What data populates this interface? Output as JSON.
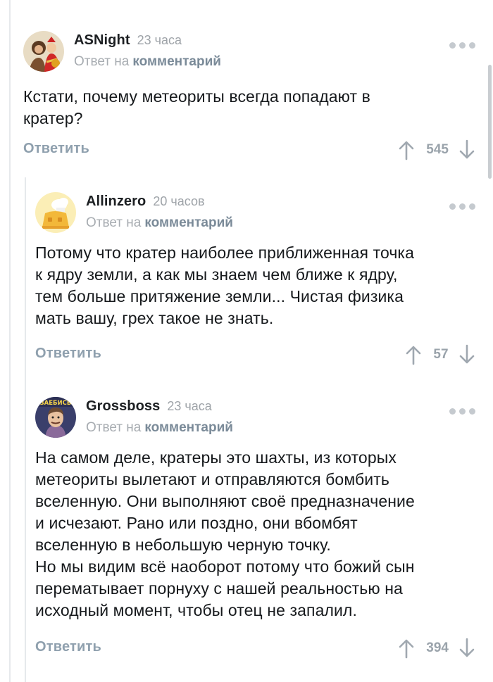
{
  "comments": [
    {
      "author": "ASNight",
      "time": "23 часа",
      "reply_prefix": "Ответ на",
      "reply_link": "комментарий",
      "body": [
        "Кстати, почему метеориты всегда попадают в",
        "кратер?"
      ],
      "reply_label": "Ответить",
      "rating": "545",
      "avatar": "avatar-asnight"
    },
    {
      "author": "Allinzero",
      "time": "20 часов",
      "reply_prefix": "Ответ на",
      "reply_link": "комментарий",
      "body": [
        "Потому что кратер наиболее приближенная точка",
        "к ядру земли, а как мы знаем чем ближе к ядру,",
        "тем больше притяжение земли... Чистая физика",
        "мать вашу, грех такое не знать."
      ],
      "reply_label": "Ответить",
      "rating": "57",
      "avatar": "avatar-allinzero"
    },
    {
      "author": "Grossboss",
      "time": "23 часа",
      "reply_prefix": "Ответ на",
      "reply_link": "комментарий",
      "avatar_text": "ЗАЕБИСЬ",
      "body": [
        "На самом деле, кратеры это шахты, из которых",
        "метеориты вылетают и отправляются бомбить",
        "вселенную. Они выполняют своё предназначение",
        "и исчезают. Рано или поздно, они вбомбят",
        "вселенную в небольшую черную точку.",
        "Но мы видим всё наоборот потому что божий сын",
        "перематывает порнуху с нашей реальностью на",
        "исходный момент, чтобы отец не запалил."
      ],
      "reply_label": "Ответить",
      "rating": "394",
      "avatar": "avatar-grossboss"
    }
  ],
  "colors": {
    "text": "#16191c",
    "muted": "#a7acb1",
    "link": "#7a8a98",
    "action": "#8fa0ae",
    "thread_line": "#e6e9ec"
  },
  "icons": [
    "more-icon",
    "arrow-up-icon",
    "arrow-down-icon"
  ]
}
